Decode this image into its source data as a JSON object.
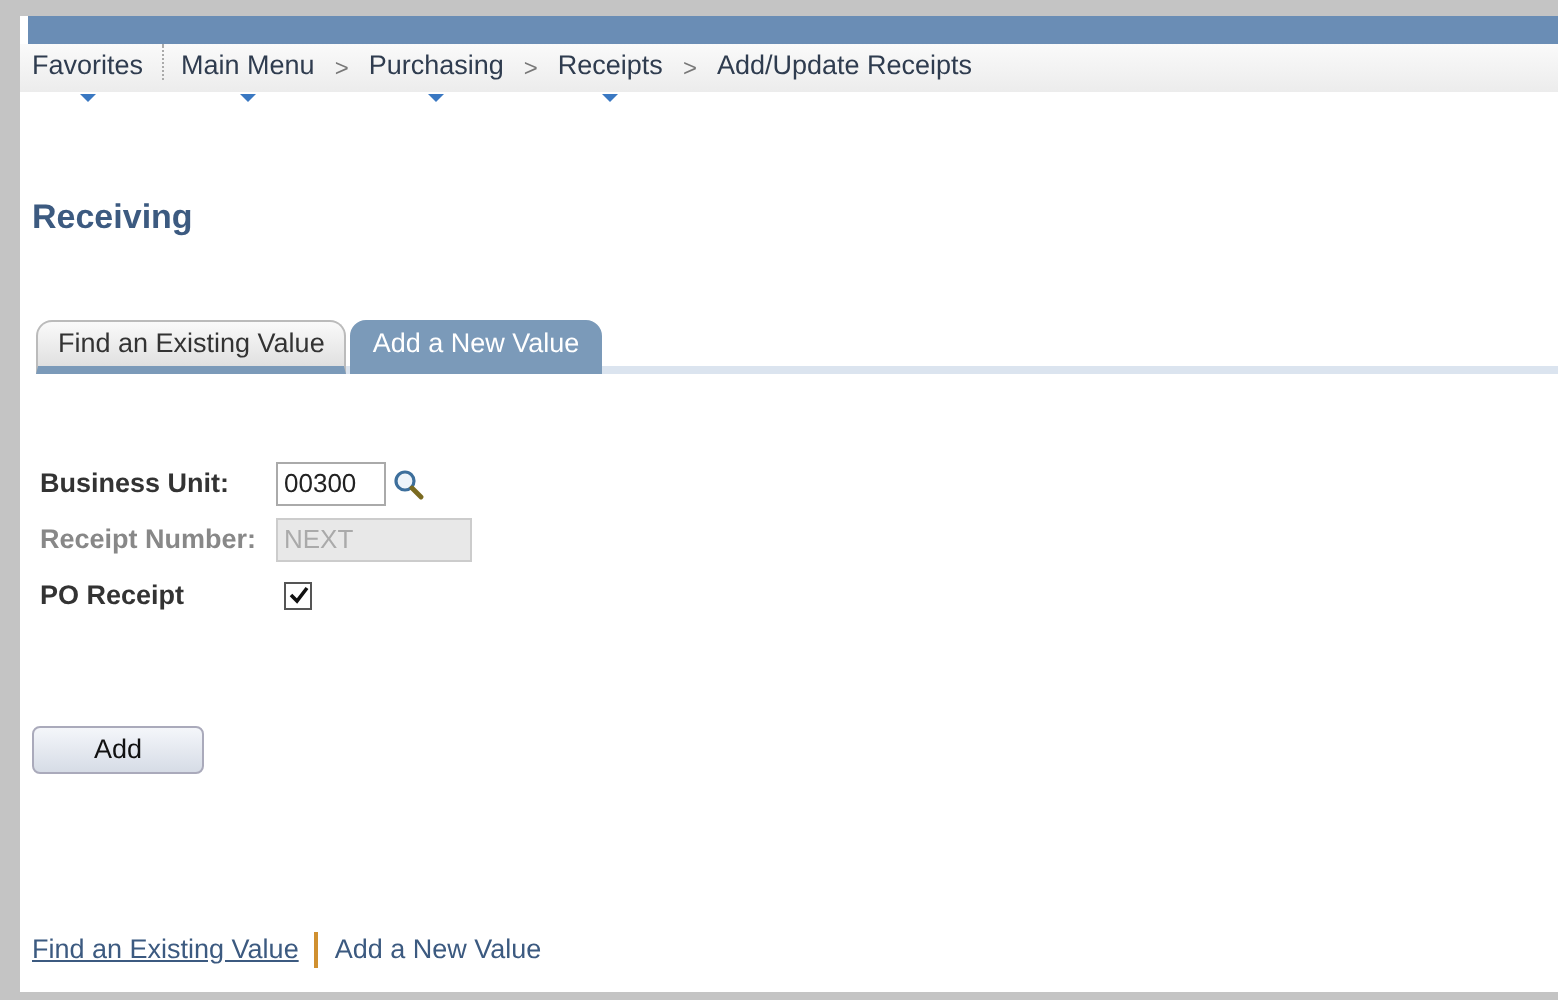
{
  "favorites": {
    "label": "Favorites",
    "dropdown": true
  },
  "breadcrumb": [
    {
      "kind": "link",
      "label": "Main Menu",
      "dropdown": true
    },
    {
      "kind": "separator",
      "label": ">"
    },
    {
      "kind": "link",
      "label": "Purchasing",
      "dropdown": true
    },
    {
      "kind": "separator",
      "label": ">"
    },
    {
      "kind": "link",
      "label": "Receipts",
      "dropdown": true
    },
    {
      "kind": "separator",
      "label": ">"
    },
    {
      "kind": "link",
      "label": "Add/Update Receipts",
      "dropdown": false
    }
  ],
  "page_title": "Receiving",
  "tabs": [
    {
      "label": "Find an Existing Value",
      "selected": false
    },
    {
      "label": "Add a New Value",
      "selected": true
    }
  ],
  "fields": [
    {
      "kind": "lookup",
      "label": "Business Unit:",
      "value": "00300",
      "disabled": false
    },
    {
      "kind": "text",
      "label": "Receipt Number:",
      "value": "NEXT",
      "disabled": true
    },
    {
      "kind": "checkbox",
      "label": "PO Receipt",
      "checked": true,
      "disabled": false
    }
  ],
  "add_button": "Add",
  "footer_links": [
    {
      "label": "Find an Existing Value",
      "selected": false
    },
    {
      "label": "Add a New Value",
      "selected": true
    }
  ]
}
